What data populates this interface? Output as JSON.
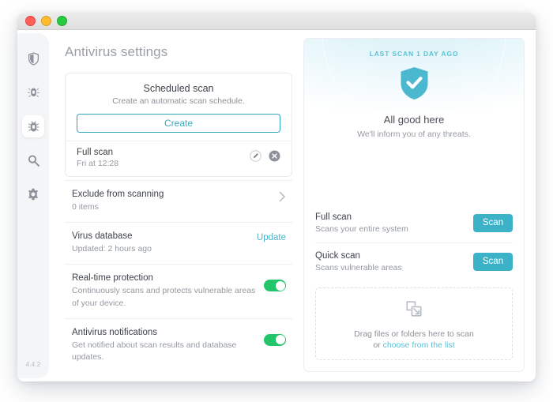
{
  "window": {
    "traffic_lights": [
      "close",
      "minimize",
      "maximize"
    ],
    "version": "4.4.2"
  },
  "sidebar": {
    "items": [
      {
        "id": "protection",
        "icon": "shield-icon",
        "active": false
      },
      {
        "id": "threats",
        "icon": "bug-alert-icon",
        "active": false
      },
      {
        "id": "antivirus",
        "icon": "bug-icon",
        "active": true
      },
      {
        "id": "search",
        "icon": "magnifier-icon",
        "active": false
      },
      {
        "id": "preferences",
        "icon": "gear-icon",
        "active": false
      }
    ]
  },
  "page": {
    "title": "Antivirus settings"
  },
  "scheduled_scan": {
    "title": "Scheduled scan",
    "subtitle": "Create an automatic scan schedule.",
    "create_label": "Create",
    "entry": {
      "name": "Full scan",
      "when": "Fri at 12:28",
      "edit_icon": "pencil-circle-icon",
      "delete_icon": "close-circle-icon"
    }
  },
  "settings_rows": [
    {
      "id": "exclude",
      "title": "Exclude from scanning",
      "subtitle": "0 items",
      "control": "chevron",
      "action_label": ""
    },
    {
      "id": "virus-database",
      "title": "Virus database",
      "subtitle": "Updated: 2 hours ago",
      "control": "link",
      "action_label": "Update"
    },
    {
      "id": "real-time-protection",
      "title": "Real-time protection",
      "subtitle": "Continuously scans and protects vulnerable areas of your device.",
      "control": "toggle",
      "toggle_on": true,
      "action_label": ""
    },
    {
      "id": "antivirus-notifications",
      "title": "Antivirus notifications",
      "subtitle": "Get notified about scan results and database updates.",
      "control": "toggle",
      "toggle_on": true,
      "action_label": ""
    }
  ],
  "status": {
    "eyebrow": "LAST SCAN 1 DAY AGO",
    "shield_icon": "shield-check-icon",
    "title": "All good here",
    "subtitle": "We'll inform you of any threats."
  },
  "scans": [
    {
      "id": "full",
      "name": "Full scan",
      "desc": "Scans your entire system",
      "button_label": "Scan"
    },
    {
      "id": "quick",
      "name": "Quick scan",
      "desc": "Scans vulnerable areas",
      "button_label": "Scan"
    }
  ],
  "dropzone": {
    "icon": "drop-files-icon",
    "line1": "Drag files or folders here to scan",
    "prefix": "or ",
    "link": "choose from the list"
  },
  "colors": {
    "accent_teal": "#3cb2c8",
    "accent_teal_light": "#5bc0d4",
    "toggle_green": "#22c56a",
    "text_dark": "#3d424a",
    "text_muted": "#9499a1"
  }
}
